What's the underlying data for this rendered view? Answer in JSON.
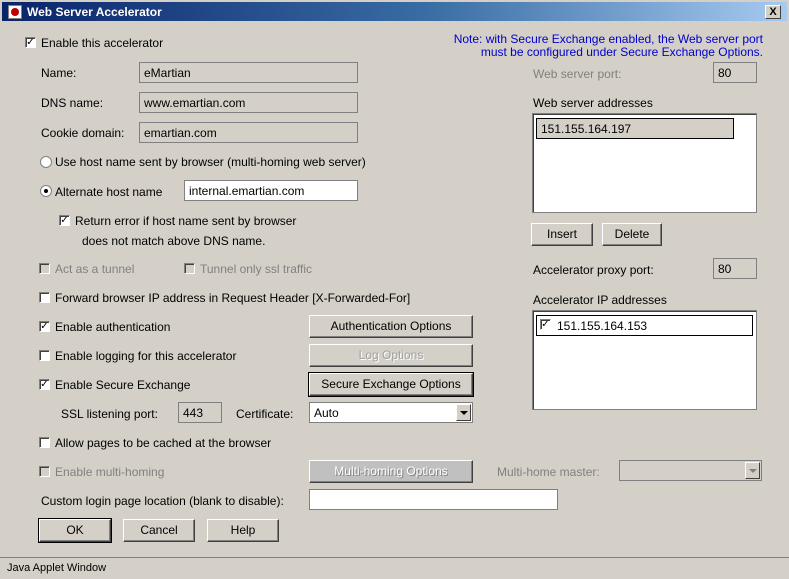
{
  "window": {
    "title": "Web Server Accelerator",
    "close_label": "X"
  },
  "note_line1": "Note: with Secure Exchange enabled, the Web server port",
  "note_line2": "must be configured under Secure Exchange Options.",
  "enable_accelerator": {
    "label": "Enable this accelerator",
    "checked": true
  },
  "name": {
    "label": "Name:",
    "value": "eMartian"
  },
  "dns_name": {
    "label": "DNS name:",
    "value": "www.emartian.com"
  },
  "cookie_domain": {
    "label": "Cookie domain:",
    "value": "emartian.com"
  },
  "use_host_name": {
    "label": "Use host name sent by browser (multi-homing web server)",
    "selected": false
  },
  "alternate_host": {
    "label": "Alternate host name",
    "selected": true,
    "value": "internal.emartian.com"
  },
  "return_error": {
    "label_line1": "Return error if host name sent by browser",
    "label_line2": "does not match above DNS name.",
    "checked": true
  },
  "act_as_tunnel": {
    "label": "Act as a tunnel",
    "checked": false
  },
  "tunnel_ssl": {
    "label": "Tunnel only ssl traffic",
    "checked": false
  },
  "forward_ip": {
    "label": "Forward browser IP address in Request Header [X-Forwarded-For]",
    "checked": false
  },
  "enable_auth": {
    "label": "Enable authentication",
    "checked": true,
    "button": "Authentication Options"
  },
  "enable_logging": {
    "label": "Enable logging for this accelerator",
    "checked": false,
    "button": "Log Options"
  },
  "enable_secure": {
    "label": "Enable Secure Exchange",
    "checked": true,
    "button": "Secure Exchange Options"
  },
  "ssl": {
    "port_label": "SSL listening port:",
    "port_value": "443",
    "cert_label": "Certificate:",
    "cert_value": "Auto"
  },
  "allow_cache": {
    "label": "Allow pages to be cached at the browser",
    "checked": false
  },
  "multi_homing": {
    "label": "Enable multi-homing",
    "checked": false,
    "button": "Multi-homing Options",
    "master_label": "Multi-home master:",
    "master_value": ""
  },
  "custom_login": {
    "label": "Custom login page location (blank to disable):",
    "value": ""
  },
  "buttons": {
    "ok": "OK",
    "cancel": "Cancel",
    "help": "Help"
  },
  "web_server_port": {
    "label": "Web server port:",
    "value": "80"
  },
  "web_server_addresses": {
    "label": "Web server addresses",
    "items": [
      "151.155.164.197"
    ]
  },
  "list_buttons": {
    "insert": "Insert",
    "delete": "Delete"
  },
  "proxy_port": {
    "label": "Accelerator proxy port:",
    "value": "80"
  },
  "accel_ips": {
    "label": "Accelerator IP addresses",
    "items": [
      {
        "checked": true,
        "address": "151.155.164.153"
      }
    ]
  },
  "status": "Java Applet Window"
}
